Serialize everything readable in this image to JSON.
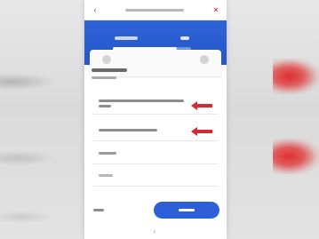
{
  "app": {
    "title": "",
    "back_icon": "back-arrow-icon",
    "close_icon": "close-icon"
  },
  "banner": {
    "label": "",
    "value": "",
    "progress": 0.82,
    "accent": "#2e63d8"
  },
  "form": {
    "section_title": "",
    "section_subtitle": "",
    "rows": [
      {
        "text": "",
        "has_arrow": true
      },
      {
        "text": "",
        "has_arrow": true
      },
      {
        "text": ""
      },
      {
        "text": ""
      }
    ]
  },
  "footer": {
    "back_label": "",
    "next_label": "",
    "next_color": "#2e5fd8"
  },
  "highlight_color": "#d9282f"
}
